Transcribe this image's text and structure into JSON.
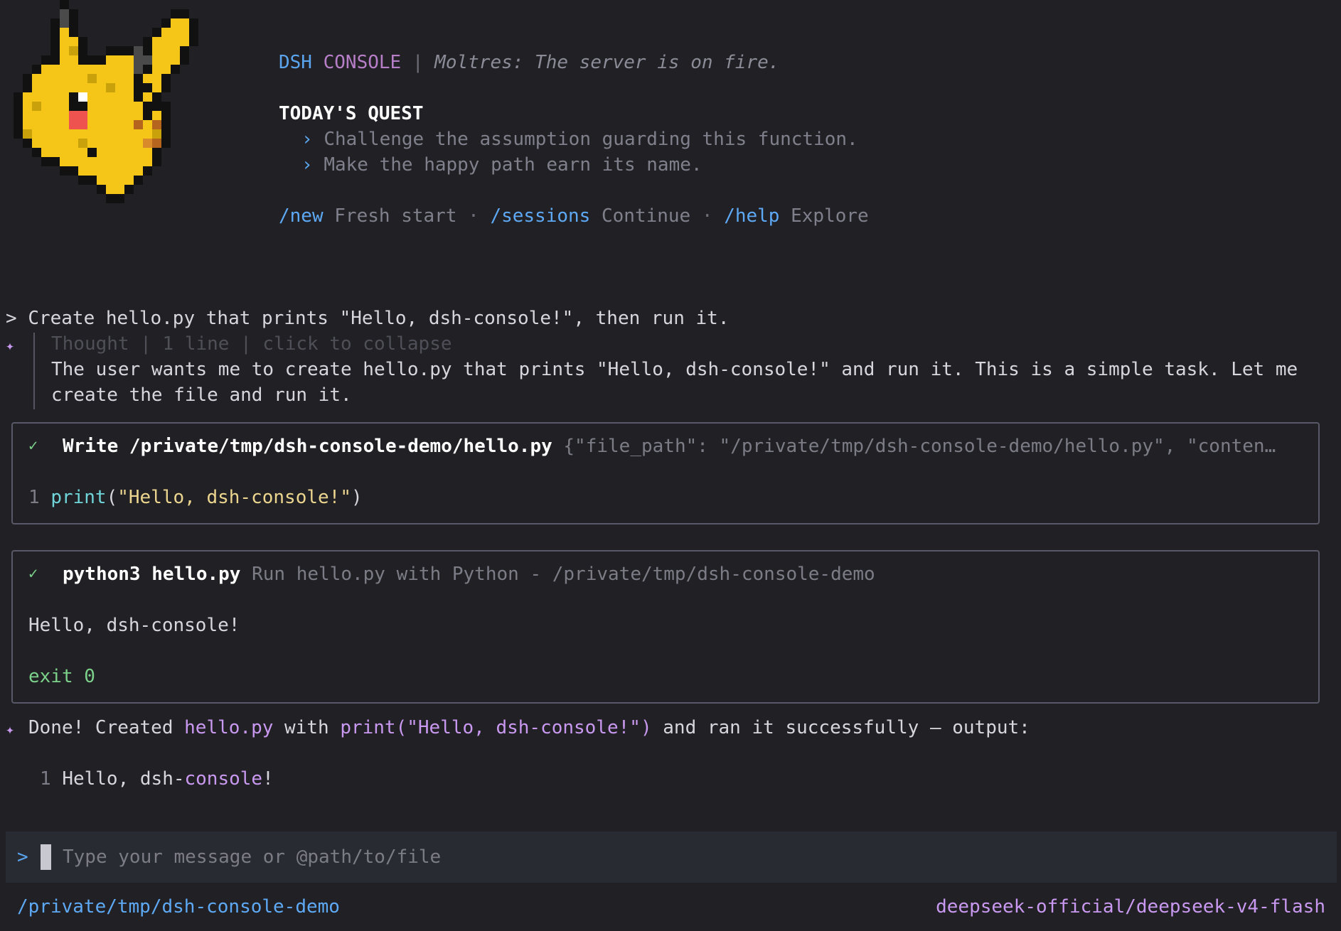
{
  "header": {
    "brand_first": "DSH",
    "brand_second": "CONSOLE",
    "separator": "|",
    "tagline": "Moltres: The server is on fire."
  },
  "quest": {
    "title": "TODAY'S QUEST",
    "bullet": "›",
    "items": [
      "Challenge the assumption guarding this function.",
      "Make the happy path earn its name."
    ]
  },
  "commands": [
    {
      "cmd": "/new",
      "desc": "Fresh start"
    },
    {
      "cmd": "/sessions",
      "desc": "Continue"
    },
    {
      "cmd": "/help",
      "desc": "Explore"
    }
  ],
  "commands_dot": "·",
  "conversation": {
    "prompt_marker": ">",
    "user_message": "Create hello.py that prints \"Hello, dsh-console!\", then run it.",
    "assistant_marker": "✦",
    "thought_header": "Thought | 1 line | click to collapse",
    "thought_lines": [
      "The user wants me to create hello.py that prints \"Hello, dsh-console!\" and run it. This is a simple task. Let me",
      "create the file and run it."
    ],
    "tool_write": {
      "check": "✓",
      "title": "Write /private/tmp/dsh-console-demo/hello.py",
      "args": "{\"file_path\": \"/private/tmp/dsh-console-demo/hello.py\", \"conten…",
      "line_no": "1",
      "code_func": "print",
      "code_open": "(",
      "code_string": "\"Hello, dsh-console!\"",
      "code_close": ")"
    },
    "tool_run": {
      "check": "✓",
      "title": "python3 hello.py",
      "desc": "Run hello.py with Python - /private/tmp/dsh-console-demo",
      "output": "Hello, dsh-console!",
      "exit": "exit 0"
    },
    "final": {
      "t1": "Done! Created ",
      "file": "hello.py",
      "t2": " with ",
      "code": "print(\"Hello, dsh-console!\")",
      "t3": " and ran it successfully — output:"
    },
    "output_block": {
      "line_no": "1",
      "prefix": "Hello, dsh-",
      "highlight": "console",
      "suffix": "!"
    }
  },
  "input": {
    "prompt": ">",
    "placeholder": "Type your message or @path/to/file"
  },
  "footer": {
    "cwd": "/private/tmp/dsh-console-demo",
    "model": "deepseek-official/deepseek-v4-flash"
  }
}
